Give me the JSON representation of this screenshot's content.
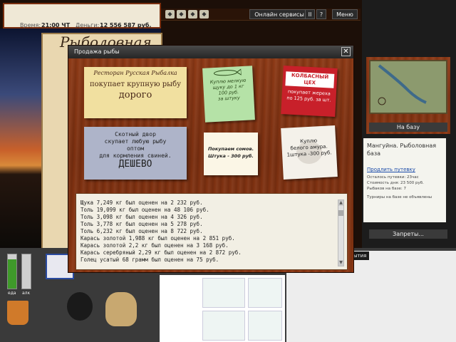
{
  "status": {
    "time_label": "Время:",
    "time_value": "21:00 ЧТ",
    "money_label": "Деньги:",
    "money_value": "12 556 587 руб."
  },
  "topbar": {
    "online_services": "Онлайн сервисы",
    "pause": "II",
    "help": "?",
    "menu": "Меню"
  },
  "book": {
    "title": "Рыболовная"
  },
  "dialog": {
    "title": "Продажа рыбы",
    "close": "✕",
    "notes": {
      "restaurant": {
        "line1": "Ресторан Русская Рыбалка",
        "line2": "покупает крупную рыбу",
        "line3": "дорого"
      },
      "small_pike": {
        "line1": "Куплю мелкую",
        "line2": "щуку до 1 кг",
        "line3": "100 руб.",
        "line4": "за штуку"
      },
      "sausage": {
        "line1": "КОЛБАСНЫЙ ЦЕХ",
        "line2": "покупает жереха",
        "line3": "по 125 руб. за шт."
      },
      "cattle": {
        "line1": "Скотный двор",
        "line2": "скупает любую рыбу",
        "line3": "оптом",
        "line4": "для кормления свиней.",
        "line5": "ДЕШЕВО"
      },
      "catfish": {
        "line1": "Покупаем сомов.",
        "line2": "Штука - 300 руб."
      },
      "amur": {
        "line1": "Куплю",
        "line2": "белого амура.",
        "line3": "1штука -300 руб."
      }
    },
    "log": [
      "Щука 7,249 кг был оценен на 2 232 руб.",
      "Толь 19,099 кг был оценен на 48 106 руб.",
      "Толь 3,098 кг был оценен на 4 326 руб.",
      "Толь 3,778 кг был оценен на 5 278 руб.",
      "Толь 6,232 кг был оценен на 8 722 руб.",
      "Карась золотой 1,988 кг был оценен на 2 851 руб.",
      "Карась золотой 2,2 кг был оценен на 3 168 руб.",
      "Карась серебряный 2,29 кг был оценен на 2 872 руб.",
      "Голец усатый 68 грамм был оценен на 75 руб."
    ]
  },
  "right": {
    "base_button": "На базу",
    "location": "Мангуйна. Рыболовная база",
    "extend_link": "Продлить путевку",
    "rows": [
      "Осталось путевки: 23час",
      "Стоимость дня: 23 500 руб.",
      "Рыбаков на базе: 7"
    ],
    "tournaments": "Турниры на базе не объявлены",
    "bans_button": "Запреты...",
    "events_tab": "ытия"
  },
  "gauges": {
    "food": {
      "label": "еда",
      "level": 0.85
    },
    "alcohol": {
      "label": "алк",
      "level": 0.0
    }
  },
  "colors": {
    "wood": "#7a2f10",
    "note_yellow": "#f1e0a0",
    "note_green": "#b5e2a7",
    "note_red": "#c8202a",
    "note_blue": "#aeb4c9",
    "gauge_green": "#3f9a2a"
  }
}
